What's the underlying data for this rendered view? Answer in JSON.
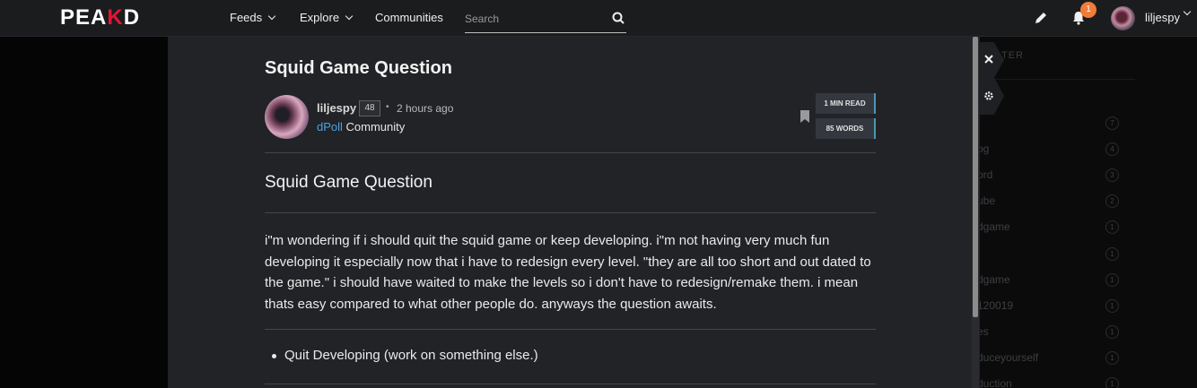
{
  "header": {
    "logo_left": "PE",
    "logo_mid": "A",
    "logo_k": "K",
    "logo_right": "D",
    "nav": [
      "Feeds",
      "Explore",
      "Communities"
    ],
    "search_placeholder": "Search",
    "notification_count": "1",
    "username": "liljespy"
  },
  "right_panel": {
    "title": "TER",
    "tags": [
      {
        "label": "",
        "count": "7"
      },
      {
        "label": "og",
        "count": "4"
      },
      {
        "label": "ord",
        "count": "3"
      },
      {
        "label": "ube",
        "count": "2"
      },
      {
        "label": "dgame",
        "count": "1"
      },
      {
        "label": "",
        "count": "1"
      },
      {
        "label": "dgame",
        "count": "1"
      },
      {
        "label": "120019",
        "count": "1"
      },
      {
        "label": "es",
        "count": "1"
      },
      {
        "label": "duceyourself",
        "count": "1"
      },
      {
        "label": "duction",
        "count": "1"
      }
    ]
  },
  "post": {
    "title": "Squid Game Question",
    "author": "liljespy",
    "reputation": "48",
    "time": "2 hours ago",
    "community_link": "dPoll",
    "community_suffix": " Community",
    "read_time": "1 MIN READ",
    "words": "85 WORDS",
    "heading": "Squid Game Question",
    "body": "i\"m wondering if i should quit the squid game or keep developing. i\"m not having very much fun developing it especially now that i have to redesign every level. \"they are all too short and out dated to the game.\" i should have waited to make the levels so i don't have to redesign/remake them. i mean thats easy compared to what other people do. anyways the question awaits.",
    "list": [
      "Quit Developing (work on something else.)"
    ]
  },
  "icons": {
    "search": "search-icon",
    "pencil": "pencil-icon",
    "bell": "bell-icon",
    "close": "close-icon",
    "gear": "gear-icon",
    "bookmark": "bookmark-icon"
  },
  "colors": {
    "brand_red": "#e31337",
    "link_blue": "#4aa3e6",
    "badge_orange": "#f07c3a"
  }
}
